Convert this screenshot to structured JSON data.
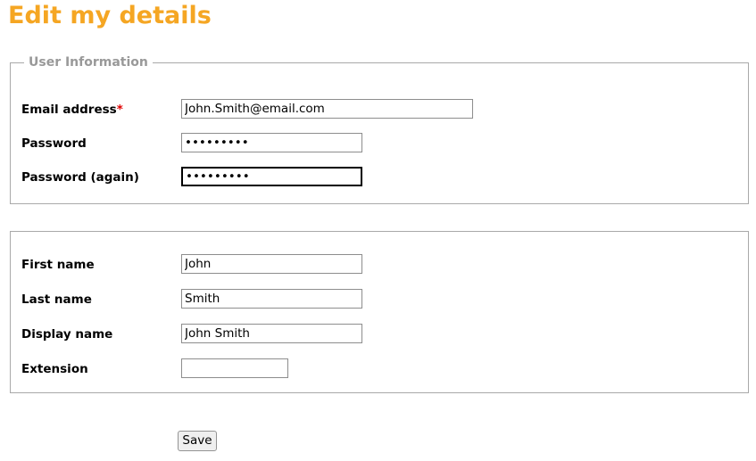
{
  "page": {
    "title": "Edit my details"
  },
  "fieldsets": [
    {
      "legend": "User Information",
      "fields": [
        {
          "label": "Email address",
          "required_marker": "*",
          "value": "John.Smith@email.com",
          "placeholder": "",
          "type": "text",
          "focused": false
        },
        {
          "label": "Password",
          "required_marker": "",
          "value": "•••••••••",
          "placeholder": "",
          "type": "password",
          "focused": false
        },
        {
          "label": "Password (again)",
          "required_marker": "",
          "value": "•••••••••",
          "placeholder": "",
          "type": "password",
          "focused": true
        }
      ]
    },
    {
      "legend": "",
      "fields": [
        {
          "label": "First name",
          "required_marker": "",
          "value": "John",
          "placeholder": "",
          "type": "text",
          "focused": false
        },
        {
          "label": "Last name",
          "required_marker": "",
          "value": "Smith",
          "placeholder": "",
          "type": "text",
          "focused": false
        },
        {
          "label": "Display name",
          "required_marker": "",
          "value": "John Smith",
          "placeholder": "",
          "type": "text",
          "focused": false
        },
        {
          "label": "Extension",
          "required_marker": "",
          "value": "",
          "placeholder": "",
          "type": "text",
          "focused": false
        }
      ]
    }
  ],
  "actions": {
    "save_label": "Save"
  },
  "colors": {
    "title_orange": "#F5A623",
    "legend_gray": "#999999",
    "required_red": "#e00000",
    "border_gray": "#a9a9a9"
  }
}
